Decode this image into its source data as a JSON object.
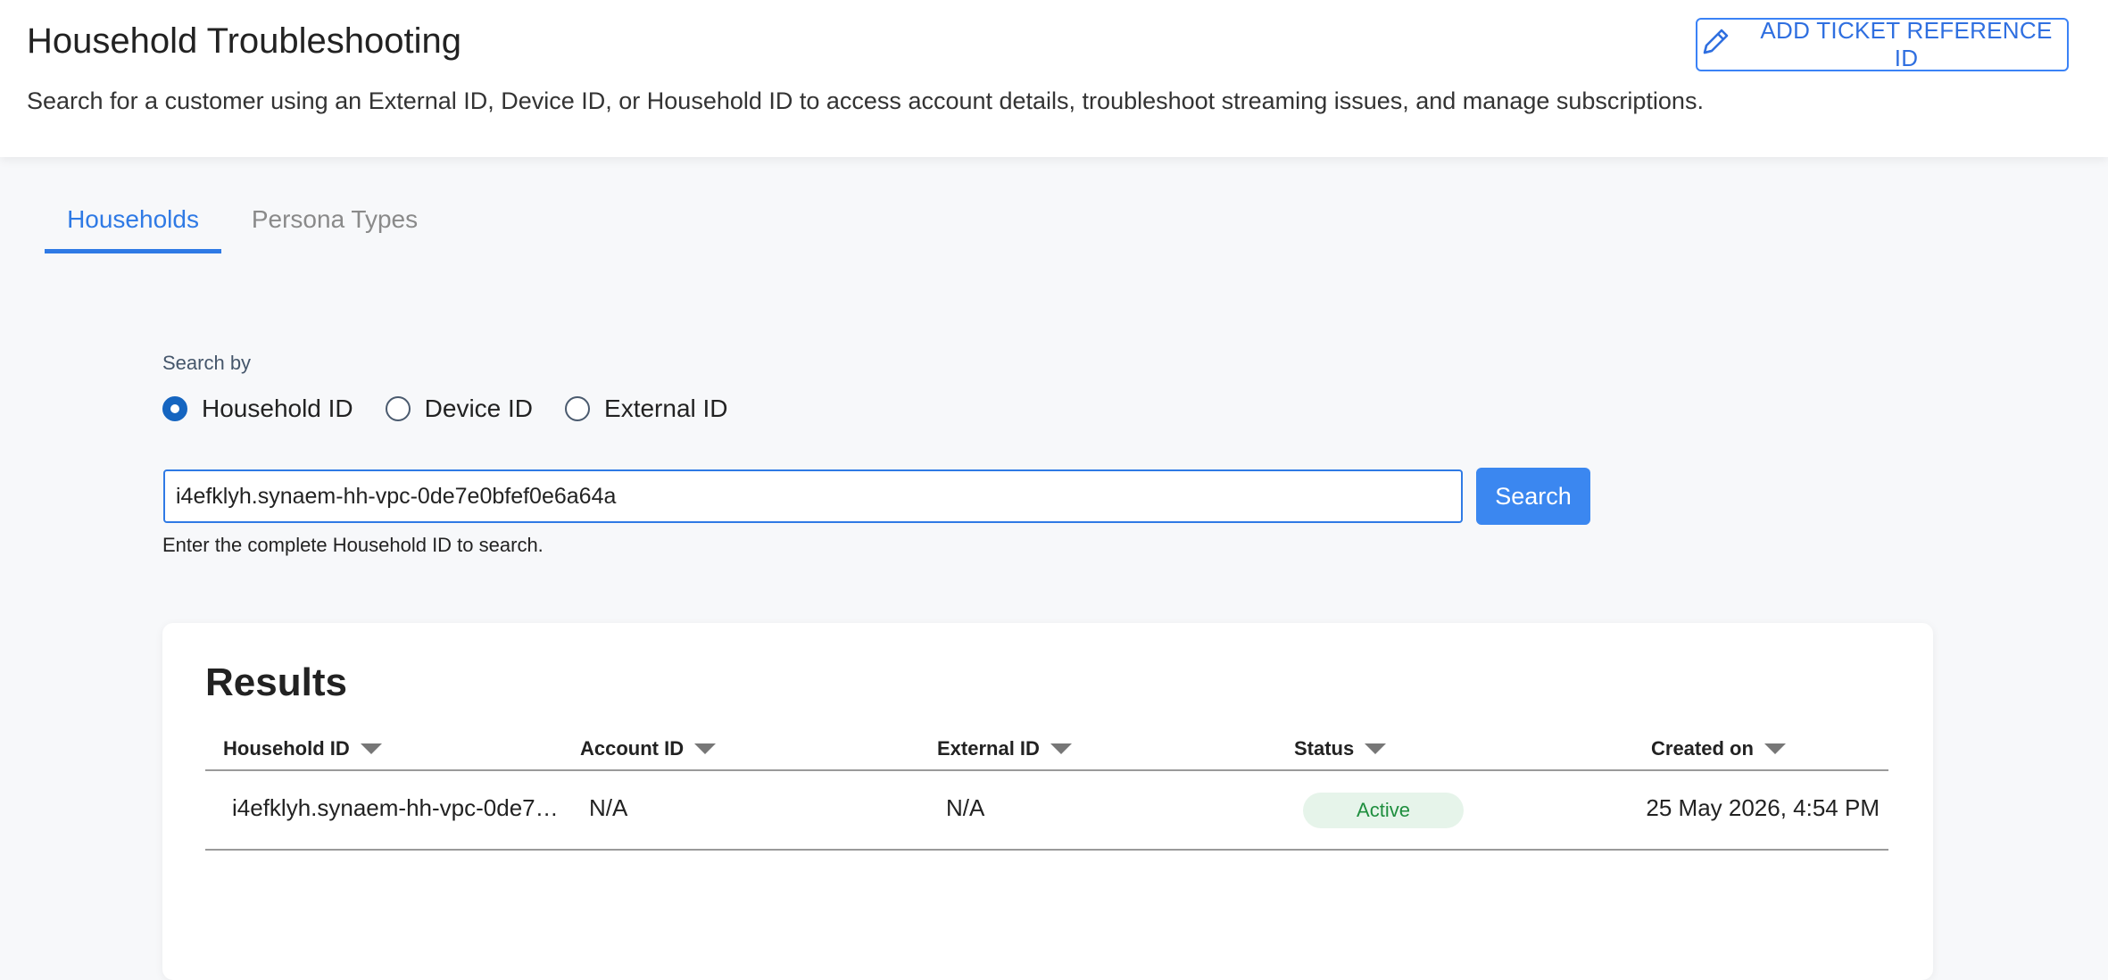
{
  "header": {
    "title": "Household Troubleshooting",
    "description": "Search for a customer using an External ID, Device ID, or Household ID to access account details, troubleshoot streaming issues, and manage subscriptions.",
    "ticket_button_label": "ADD TICKET REFERENCE ID",
    "ticket_button_icon": "pencil-icon"
  },
  "tabs": [
    {
      "label": "Households",
      "active": true
    },
    {
      "label": "Persona Types",
      "active": false
    }
  ],
  "search": {
    "label": "Search by",
    "options": [
      {
        "label": "Household ID",
        "selected": true
      },
      {
        "label": "Device ID",
        "selected": false
      },
      {
        "label": "External ID",
        "selected": false
      }
    ],
    "value": "i4efklyh.synaem-hh-vpc-0de7e0bfef0e6a64a",
    "button_label": "Search",
    "helper": "Enter the complete Household ID to search."
  },
  "results": {
    "title": "Results",
    "columns": [
      "Household ID",
      "Account ID",
      "External ID",
      "Status",
      "Created on"
    ],
    "rows": [
      {
        "household_id": "i4efklyh.synaem-hh-vpc-0de7e0bfef0e6a64a",
        "account_id": "N/A",
        "external_id": "N/A",
        "status": "Active",
        "created_on": "25 May 2026, 4:54 PM"
      }
    ]
  },
  "colors": {
    "accent": "#2f7ae5",
    "button": "#3b87f0",
    "status_active_bg": "#e6f4ea",
    "status_active_text": "#1e8e3e"
  }
}
